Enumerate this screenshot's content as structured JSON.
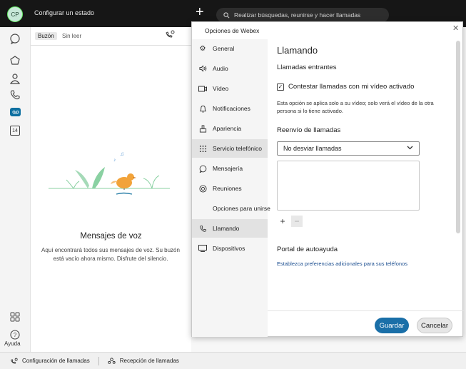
{
  "topbar": {
    "avatar_initials": "CP",
    "status_text": "Configurar un estado",
    "search_placeholder": "Realizar búsquedas, reunirse y hacer llamadas"
  },
  "rail": {
    "help_label": "Ayuda",
    "calendar_day": "14"
  },
  "voicemail": {
    "tabs": [
      "Buzón",
      "Sin leer"
    ],
    "title": "Mensajes de voz",
    "description": "Aquí encontrará todos sus mensajes de voz. Su buzón está vacío ahora mismo. Disfrute del silencio."
  },
  "bottombar": {
    "call_settings": "Configuración de llamadas",
    "call_pickup": "Recepción de llamadas"
  },
  "dialog": {
    "title": "Opciones de Webex",
    "nav": [
      {
        "label": "General",
        "icon": "gear-icon"
      },
      {
        "label": "Audio",
        "icon": "speaker-icon"
      },
      {
        "label": "Vídeo",
        "icon": "video-icon"
      },
      {
        "label": "Notificaciones",
        "icon": "bell-icon"
      },
      {
        "label": "Apariencia",
        "icon": "paint-icon"
      },
      {
        "label": "Servicio telefónico",
        "icon": "dialpad-icon"
      },
      {
        "label": "Mensajería",
        "icon": "chat-icon"
      },
      {
        "label": "Reuniones",
        "icon": "meetings-icon"
      },
      {
        "label": "Opciones para unirse",
        "icon": ""
      },
      {
        "label": "Llamando",
        "icon": "phone-icon"
      },
      {
        "label": "Dispositivos",
        "icon": "devices-icon"
      }
    ],
    "selected_nav": "Llamando",
    "content": {
      "heading": "Llamando",
      "incoming_heading": "Llamadas entrantes",
      "answer_video_label": "Contestar llamadas con mi vídeo activado",
      "answer_video_checked": true,
      "note": "Esta opción se aplica solo a su vídeo; solo verá el vídeo de la otra persona si lo tiene activado.",
      "forwarding_heading": "Reenvío de llamadas",
      "forwarding_value": "No desviar llamadas",
      "add_symbol": "+",
      "remove_symbol": "−",
      "portal_heading": "Portal de autoayuda",
      "portal_link": "Establezca preferencias adicionales para sus teléfonos"
    },
    "save_label": "Guardar",
    "cancel_label": "Cancelar"
  },
  "colors": {
    "accent": "#1a6fa8",
    "topbar": "#161616",
    "active_rail": "#0d6fa0"
  }
}
